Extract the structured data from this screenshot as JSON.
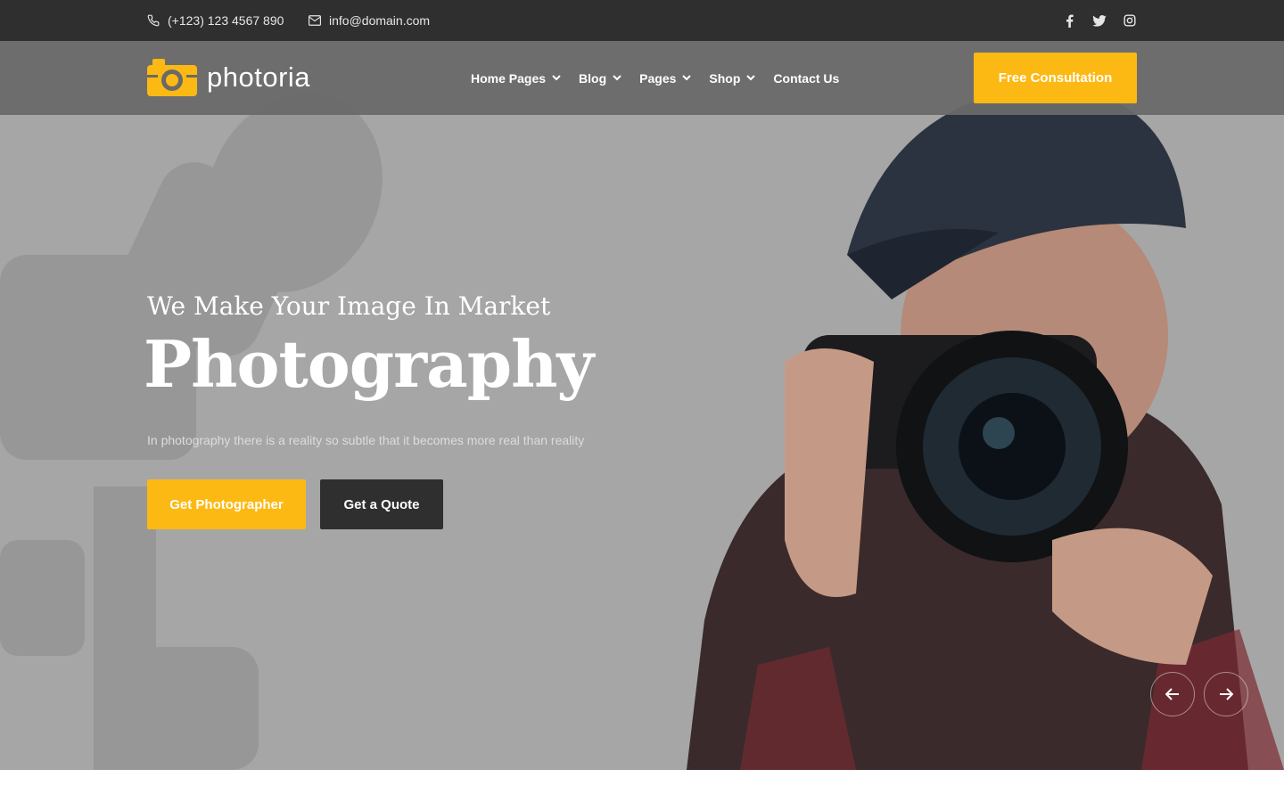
{
  "topbar": {
    "phone": "(+123) 123 4567 890",
    "email": "info@domain.com",
    "social": [
      "facebook-icon",
      "twitter-icon",
      "instagram-icon"
    ]
  },
  "brand": {
    "name": "photoria",
    "accent_color": "#fdb913"
  },
  "nav": {
    "items": [
      {
        "label": "Home Pages",
        "has_dropdown": true
      },
      {
        "label": "Blog",
        "has_dropdown": true
      },
      {
        "label": "Pages",
        "has_dropdown": true
      },
      {
        "label": "Shop",
        "has_dropdown": true
      },
      {
        "label": "Contact Us",
        "has_dropdown": false
      }
    ],
    "cta_label": "Free Consultation"
  },
  "hero": {
    "subtitle": "We Make Your Image In Market",
    "title": "Photography",
    "description": "In photography there is a reality so subtle that it becomes more real than reality",
    "primary_button": "Get Photographer",
    "secondary_button": "Get a Quote",
    "dark_color": "#2f2f2f"
  },
  "slider": {
    "prev_icon": "arrow-left-icon",
    "next_icon": "arrow-right-icon"
  }
}
